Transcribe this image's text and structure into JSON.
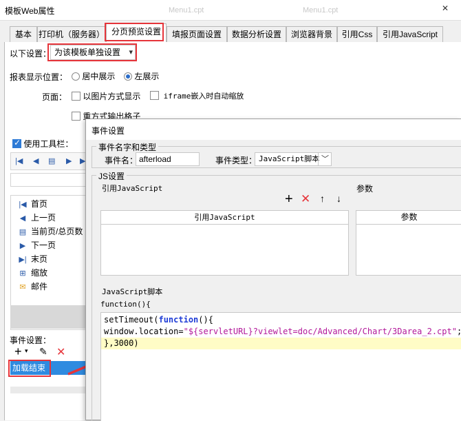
{
  "main": {
    "title": "模板Web属性",
    "close_glyph": "✕",
    "ghost_titles": [
      "Menu1.cpt",
      "Menu1.cpt"
    ],
    "tabs": [
      "基本",
      "打印机（服务器）",
      "分页预览设置",
      "填报页面设置",
      "数据分析设置",
      "浏览器背景",
      "引用Css",
      "引用JavaScript"
    ],
    "settings_label": "以下设置：",
    "settings_value": "为该模板单独设置",
    "position_label": "报表显示位置：",
    "position_center": "居中展示",
    "position_left": "左展示",
    "page_label": "页面：",
    "image_mode": "以图片方式显示",
    "iframe_zoom": "iframe嵌入时自动缩放",
    "reprint": "重方式输出格子",
    "toolbar_label": "使用工具栏：",
    "toolbar_items": [
      {
        "label": "首页",
        "icon": "first-page-icon"
      },
      {
        "label": "上一页",
        "icon": "prev-page-icon"
      },
      {
        "label": "当前页/总页数",
        "icon": "page-count-icon"
      },
      {
        "label": "下一页",
        "icon": "next-page-icon"
      },
      {
        "label": "末页",
        "icon": "last-page-icon"
      },
      {
        "label": "缩放",
        "icon": "zoom-icon"
      },
      {
        "label": "邮件",
        "icon": "mail-icon"
      }
    ],
    "event_settings_label": "事件设置：",
    "event_item": "加载结束"
  },
  "event_dialog": {
    "title": "事件设置",
    "name_type_group": "事件名字和类型",
    "name_label": "事件名：",
    "name_value": "afterload",
    "type_label": "事件类型：",
    "type_value": "JavaScript脚本",
    "js_group": "JS设置",
    "ref_js_label": "引用JavaScript",
    "params_label": "参数",
    "ref_js_header": "引用JavaScript",
    "params_header": "参数",
    "script_label": "JavaScript脚本",
    "code_head": "function(){",
    "code_lines": [
      "setTimeout(function(){",
      "window.location=\"${servletURL}?viewlet=doc/Advanced/Chart/3Darea_2.cpt\";",
      "},3000)"
    ]
  },
  "colors": {
    "highlight_red": "#e6343a",
    "accent_blue": "#2e7bd6",
    "selection_blue": "#2f8be0"
  }
}
